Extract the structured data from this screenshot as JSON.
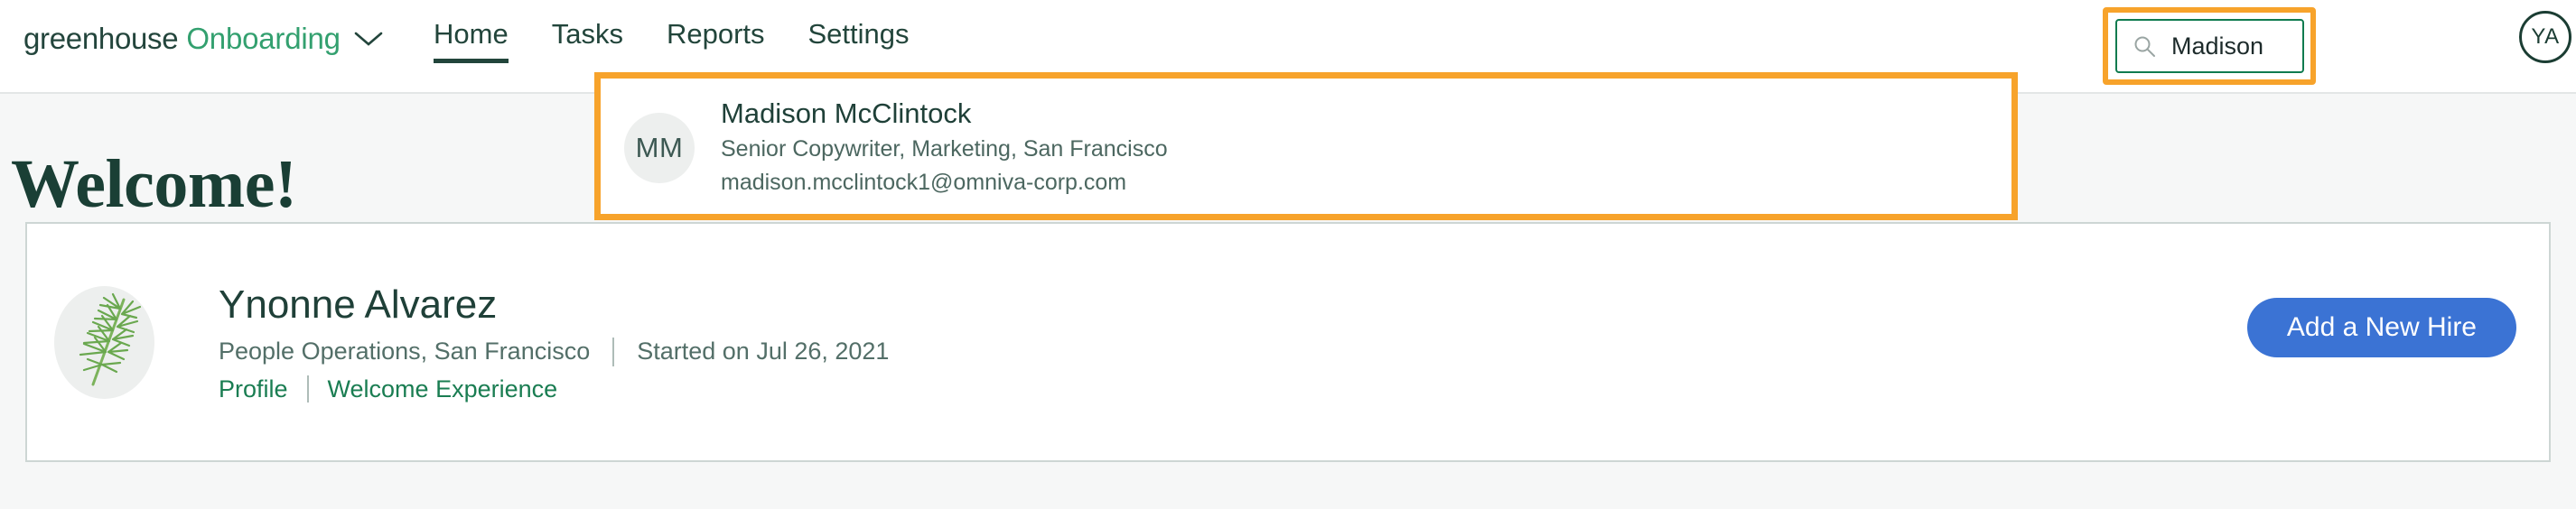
{
  "brand": {
    "company": "greenhouse",
    "product": "Onboarding",
    "caret_icon": "chevron-down-icon"
  },
  "nav": {
    "items": [
      {
        "label": "Home",
        "active": true
      },
      {
        "label": "Tasks",
        "active": false
      },
      {
        "label": "Reports",
        "active": false
      },
      {
        "label": "Settings",
        "active": false
      }
    ]
  },
  "search": {
    "icon": "search-icon",
    "value": "Madison",
    "placeholder": "Search",
    "highlight_color": "#f7a32b",
    "border_color": "#0f7b4f"
  },
  "account": {
    "avatar_initials": "YA"
  },
  "search_result": {
    "avatar_initials": "MM",
    "name": "Madison McClintock",
    "subtitle": "Senior Copywriter, Marketing, San Francisco",
    "email": "madison.mcclintock1@omniva-corp.com"
  },
  "page": {
    "title": "Welcome!"
  },
  "hire_card": {
    "avatar_icon": "plant-sprig-avatar",
    "name": "Ynonne Alvarez",
    "department_location": "People Operations, San Francisco",
    "start_date": "Started on Jul 26, 2021",
    "links": [
      {
        "label": "Profile"
      },
      {
        "label": "Welcome Experience"
      }
    ],
    "primary_button": "Add a New Hire",
    "primary_button_color": "#3b73d4"
  }
}
